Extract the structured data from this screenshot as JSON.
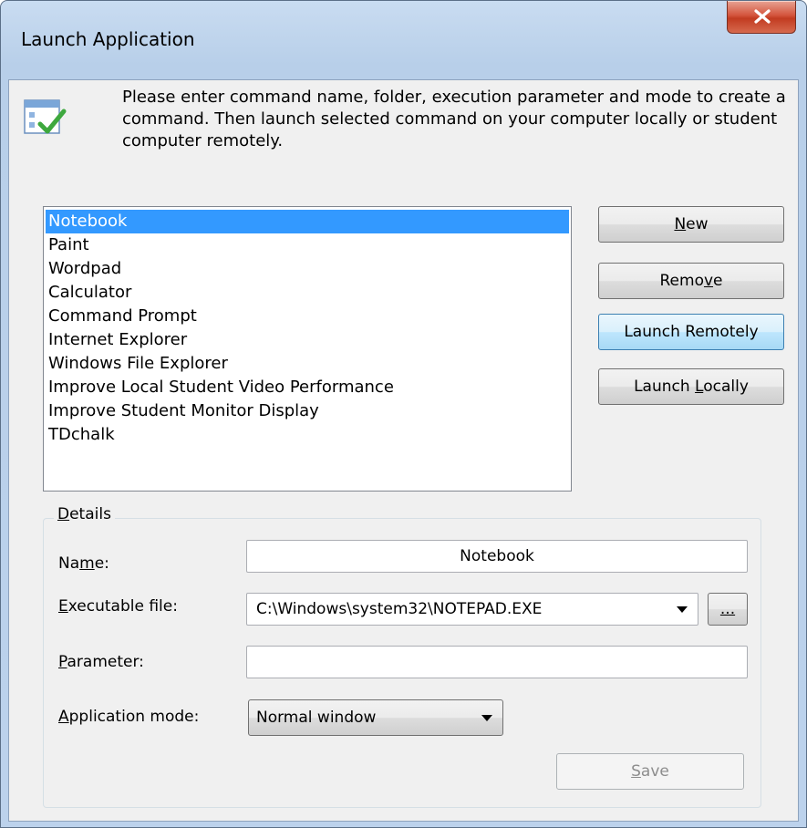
{
  "window": {
    "title": "Launch Application",
    "close_glyph": "✕"
  },
  "header": {
    "icon": "checklist-icon",
    "intro": "Please enter command name, folder, execution parameter and mode to create a command. Then launch selected command on your computer locally or student computer remotely."
  },
  "commands": {
    "selected_index": 0,
    "items": [
      "Notebook",
      "Paint",
      "Wordpad",
      "Calculator",
      "Command Prompt",
      "Internet Explorer",
      "Windows File Explorer",
      "Improve Local Student Video Performance",
      "Improve Student Monitor Display",
      "TDchalk"
    ]
  },
  "buttons": {
    "new": {
      "pre": "",
      "key": "N",
      "post": "ew"
    },
    "remove": {
      "pre": "Remo",
      "key": "v",
      "post": "e"
    },
    "launch_remotely": {
      "pre": "Launch Remotely",
      "key": "",
      "post": ""
    },
    "launch_locally": {
      "pre": "Launch ",
      "key": "L",
      "post": "ocally"
    }
  },
  "details": {
    "group_label": {
      "pre": "",
      "key": "D",
      "post": "etails"
    },
    "name_label": {
      "pre": "Na",
      "key": "m",
      "post": "e:"
    },
    "name_value": "Notebook",
    "exe_label": {
      "pre": "",
      "key": "E",
      "post": "xecutable file:"
    },
    "exe_value": "C:\\Windows\\system32\\NOTEPAD.EXE",
    "browse_label": "...",
    "param_label": {
      "pre": "",
      "key": "P",
      "post": "arameter:"
    },
    "param_value": "",
    "mode_label": {
      "pre": "",
      "key": "A",
      "post": "pplication mode:"
    },
    "mode_value": "Normal window",
    "save": {
      "pre": "",
      "key": "S",
      "post": "ave"
    }
  },
  "colors": {
    "selection": "#3399ff",
    "close_button": "#c23b21",
    "focused_button_border": "#3c7fb1"
  }
}
